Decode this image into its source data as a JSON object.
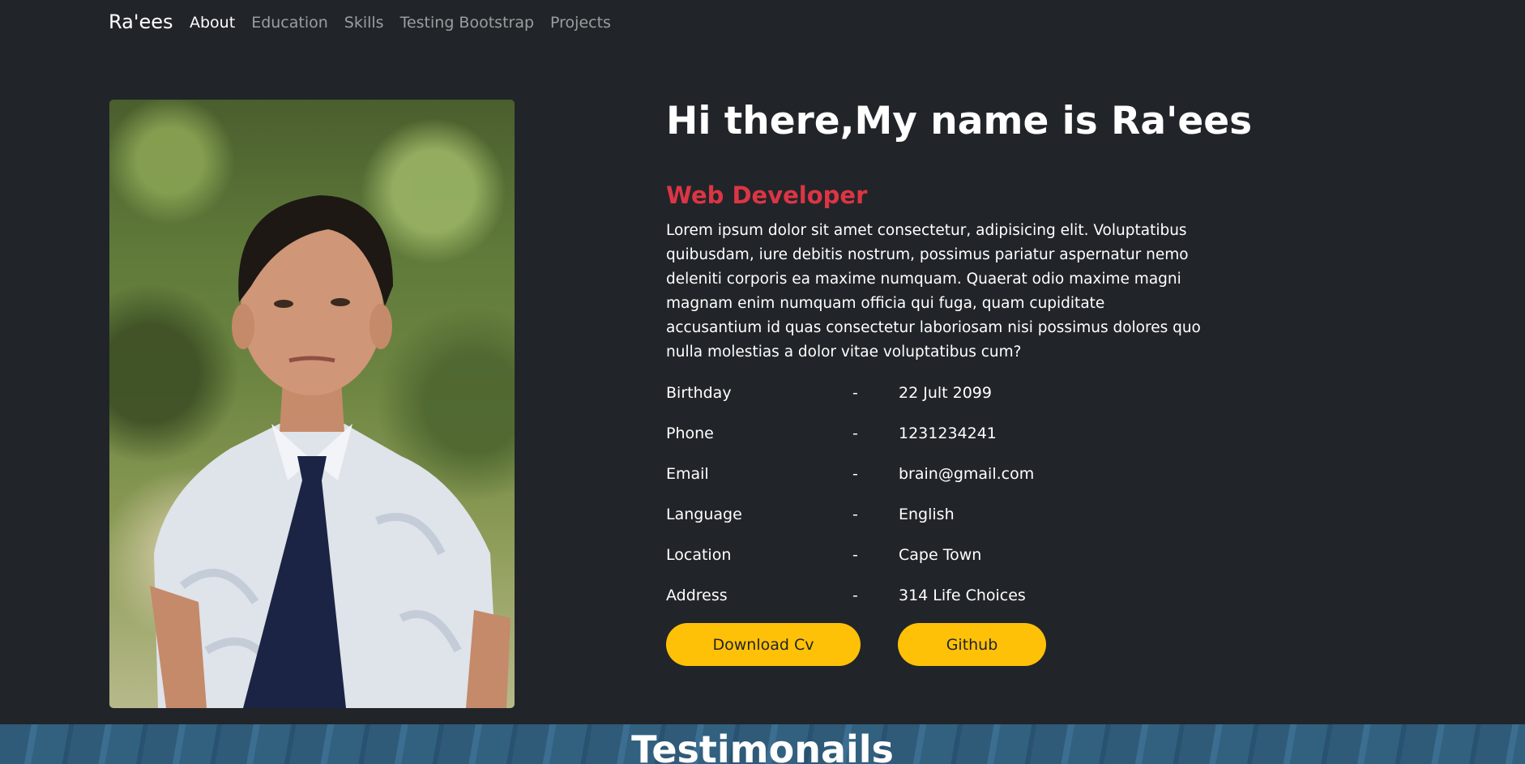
{
  "nav": {
    "brand": "Ra'ees",
    "links": [
      {
        "label": "About",
        "active": true
      },
      {
        "label": "Education",
        "active": false
      },
      {
        "label": "Skills",
        "active": false
      },
      {
        "label": "Testing Bootstrap",
        "active": false
      },
      {
        "label": "Projects",
        "active": false
      }
    ]
  },
  "about": {
    "headline": "Hi there,My name is Ra'ees",
    "role": "Web Developer",
    "bio": "Lorem ipsum dolor sit amet consectetur, adipisicing elit. Voluptatibus quibusdam, iure debitis nostrum, possimus pariatur aspernatur nemo deleniti corporis ea maxime numquam. Quaerat odio maxime magni magnam enim numquam officia qui fuga, quam cupiditate accusantium id quas consectetur laboriosam nisi possimus dolores quo nulla molestias a dolor vitae voluptatibus cum?",
    "info": [
      {
        "label": "Birthday",
        "sep": "-",
        "value": "22 Jult 2099"
      },
      {
        "label": "Phone",
        "sep": "-",
        "value": "1231234241"
      },
      {
        "label": "Email",
        "sep": "-",
        "value": "brain@gmail.com"
      },
      {
        "label": "Language",
        "sep": "-",
        "value": "English"
      },
      {
        "label": "Location",
        "sep": "-",
        "value": "Cape Town"
      },
      {
        "label": "Address",
        "sep": "-",
        "value": "314 Life Choices"
      }
    ],
    "buttons": {
      "download_cv": "Download Cv",
      "github": "Github"
    }
  },
  "testimonials": {
    "title": "Testimonails"
  },
  "colors": {
    "background": "#212529",
    "accent_red": "#dc3545",
    "button_yellow": "#ffc107"
  }
}
